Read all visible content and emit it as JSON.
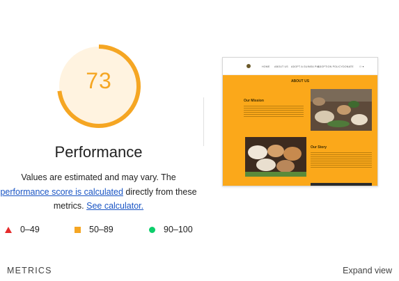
{
  "score": {
    "value": "73",
    "fraction": 0.73,
    "color": "#f5a623",
    "track_color": "#fff3e0"
  },
  "category_title": "Performance",
  "description": {
    "line1": "Values are estimated and may vary. The",
    "score_link": "performance score is calculated",
    "line2_rest": " directly from these",
    "line3": "metrics. ",
    "calculator_link": "See calculator."
  },
  "legend": [
    {
      "range": "0–49",
      "shape": "triangle",
      "color": "#e52b2b"
    },
    {
      "range": "50–89",
      "shape": "square",
      "color": "#f5a623"
    },
    {
      "range": "90–100",
      "shape": "circle",
      "color": "#0cce6b"
    }
  ],
  "metrics_label": "METRICS",
  "expand_label": "Expand view",
  "screenshot": {
    "nav_links": [
      "HOME",
      "ABOUT US",
      "ADOPT A GUINEA PIG",
      "ADOPTION POLICY",
      "DONATE"
    ],
    "heading": "ABOUT US",
    "mission_title": "Our Mission",
    "story_title": "Our Story",
    "bg_color": "#fba81a"
  }
}
